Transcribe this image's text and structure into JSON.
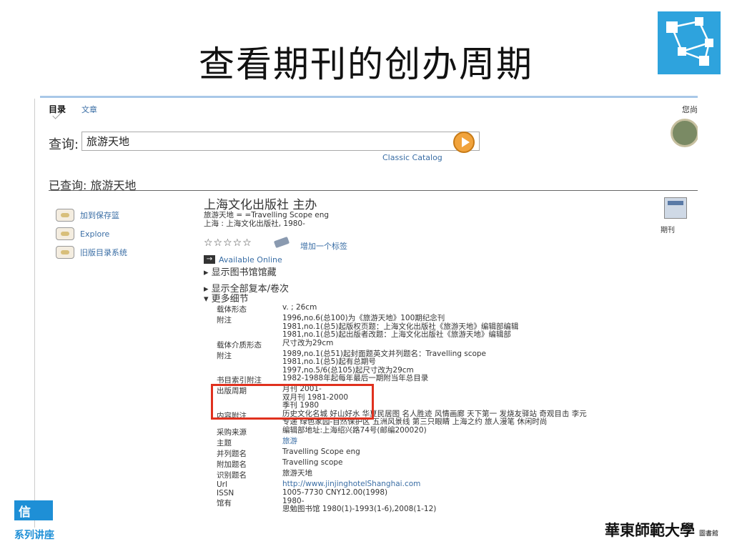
{
  "slide": {
    "title": "查看期刊的创办周期",
    "footer_badge": "信",
    "footer_series": "系列讲座",
    "university_name": "華東師範大學",
    "university_sub": "圖書館"
  },
  "nav": {
    "tab_catalog": "目录",
    "tab_articles": "文章",
    "user_status": "您尚"
  },
  "search": {
    "label": "查询:",
    "value": "旅游天地",
    "classic_link": "Classic Catalog"
  },
  "searched": {
    "text": "已查询: 旅游天地"
  },
  "sidebar": {
    "items": [
      {
        "label": "加到保存篮"
      },
      {
        "label": "Explore"
      },
      {
        "label": "旧版目录系统"
      }
    ]
  },
  "record": {
    "publisher_heading": "上海文化出版社 主办",
    "title_line": "旅游天地 = =Travelling Scope eng",
    "imprint": "上海 : 上海文化出版社, 1980-",
    "stars": "☆☆☆☆☆",
    "add_tag": "增加一个标签",
    "available_online": "Available Online",
    "show_holdings": "▸ 显示图书馆馆藏",
    "show_all_copies": "▸ 显示全部复本/卷次",
    "more_details": "▾ 更多细节",
    "format_label": "期刊"
  },
  "details": [
    {
      "label": "载体形态",
      "values": [
        "v. ; 26cm"
      ]
    },
    {
      "label": "附注",
      "values": [
        "1996,no.6(总100)为《旅游天地》100期纪念刊",
        "1981,no.1(总5)起版权页题：上海文化出版社《旅游天地》编辑部编辑",
        "1981,no.1(总5)起出版者改题：上海文化出版社《旅游天地》编辑部"
      ]
    },
    {
      "label": "载体介质形态",
      "values": [
        "尺寸改为29cm"
      ]
    },
    {
      "label": "附注",
      "values": [
        "1989,no.1(总51)起封面题英文并列题名：Travelling scope",
        "1981,no.1(总5)起有总期号",
        "1997,no.5/6(总105)起尺寸改为29cm"
      ]
    },
    {
      "label": "书目索引附注",
      "values": [
        "1982-1988年起每年最后一期附当年总目录"
      ]
    },
    {
      "label": "出版周期",
      "values": [
        "月刊 2001-",
        "双月刊 1981-2000",
        "季刊 1980"
      ]
    },
    {
      "label": "内容附注",
      "values": [
        "历史文化名城 好山好水 华夏民居图 名人胜迹 风情画廊 天下第一 发烧友驿站 奇观目击 李元",
        "专递 绿色家园-自然保护区 五洲风景线 第三只眼睛 上海之约 旅人漫笔 休闲时尚"
      ]
    },
    {
      "label": "采购来源",
      "values": [
        "编辑部地址:上海绍兴路74号(邮编200020)"
      ]
    },
    {
      "label": "主题",
      "values": [
        "旅游"
      ]
    },
    {
      "label": "并列题名",
      "values": [
        "Travelling Scope eng"
      ]
    },
    {
      "label": "附加题名",
      "values": [
        "Travelling scope"
      ]
    },
    {
      "label": "识别题名",
      "values": [
        "旅游天地"
      ]
    },
    {
      "label": "Url",
      "values": [
        "http://www.jinjinghotelShanghai.com"
      ]
    },
    {
      "label": "ISSN",
      "values": [
        "1005-7730 CNY12.00(1998)"
      ]
    },
    {
      "label": "馆有",
      "values": [
        "1980-",
        "思勉图书馆 1980(1)-1993(1-6),2008(1-12)"
      ]
    }
  ],
  "colors": {
    "accent_blue": "#2ea3dd",
    "link_blue": "#3a6ea5",
    "highlight_red": "#e0311e",
    "rule_blue": "#a9c8e8"
  }
}
